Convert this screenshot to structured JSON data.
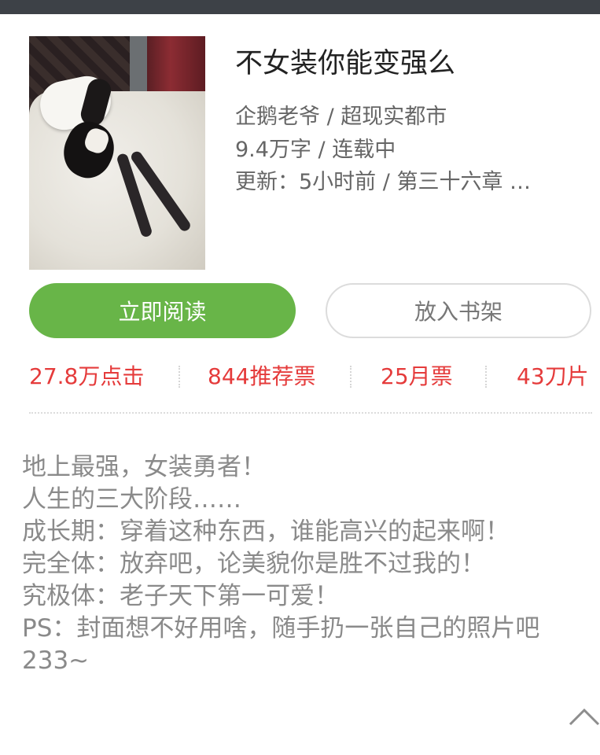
{
  "book": {
    "title": "不女装你能变强么",
    "author_genre": "企鹅老爷 / 超现实都市",
    "words_status": "9.4万字 / 连载中",
    "update": "更新：5小时前 / 第三十六章 …"
  },
  "actions": {
    "read_label": "立即阅读",
    "shelf_label": "放入书架"
  },
  "stats": [
    "27.8万点击",
    "844推荐票",
    "25月票",
    "43刀片"
  ],
  "description": [
    "地上最强，女装勇者！",
    "人生的三大阶段……",
    "成长期：穿着这种东西，谁能高兴的起来啊！",
    "完全体：放弃吧，论美貌你是胜不过我的！",
    "究极体：老子天下第一可爱！",
    "PS：封面想不好用啥，随手扔一张自己的照片吧233~"
  ],
  "colors": {
    "accent_green": "#68b548",
    "stat_red": "#e53b3b",
    "topbar": "#3d4147"
  },
  "icons": {
    "scroll_top": "chevron-up-icon"
  }
}
